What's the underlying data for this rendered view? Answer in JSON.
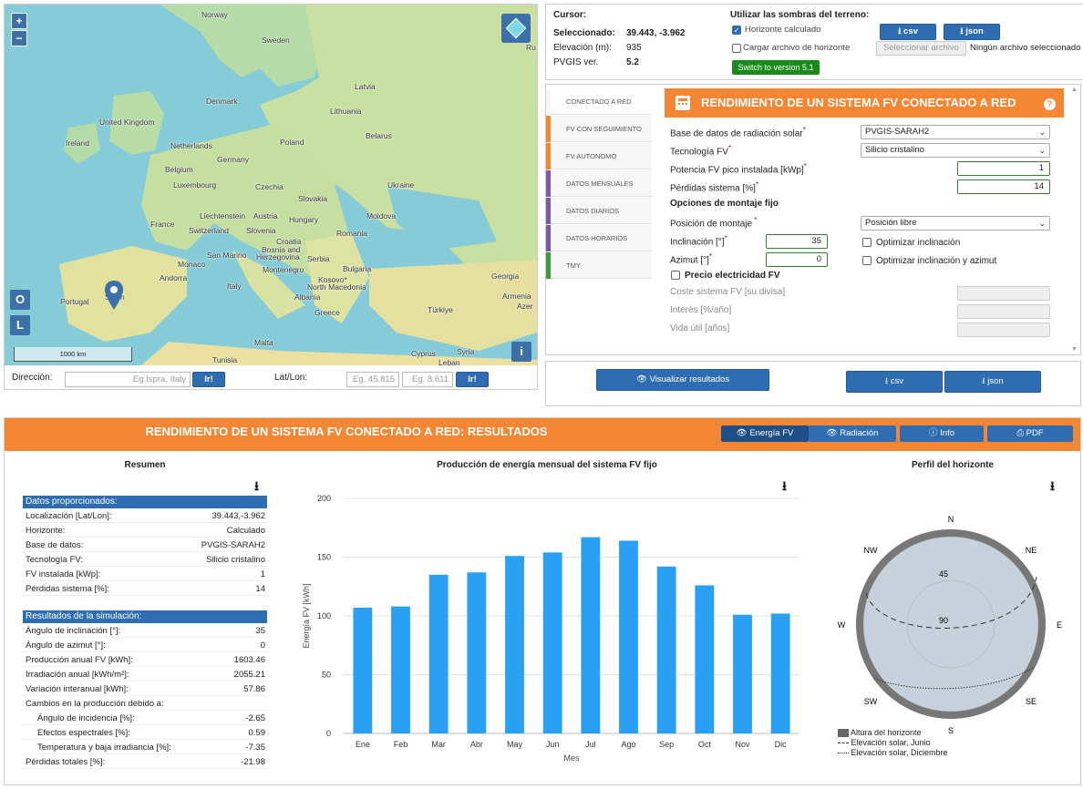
{
  "map": {
    "zoom_in": "+",
    "zoom_out": "−",
    "btn_o": "O",
    "btn_l": "L",
    "btn_i": "i",
    "scale": "1000 km",
    "labels": [
      {
        "t": "Norway",
        "key": "norway"
      },
      {
        "t": "Sweden",
        "key": "sweden"
      },
      {
        "t": "Latvia",
        "key": "latvia"
      },
      {
        "t": "Lithuania",
        "key": "lithuania"
      },
      {
        "t": "Denmark",
        "key": "denmark"
      },
      {
        "t": "United Kingdom",
        "key": "uk"
      },
      {
        "t": "Ireland",
        "key": "ireland"
      },
      {
        "t": "Netherlands",
        "key": "netherlands"
      },
      {
        "t": "Belarus",
        "key": "belarus"
      },
      {
        "t": "Germany",
        "key": "germany"
      },
      {
        "t": "Poland",
        "key": "poland"
      },
      {
        "t": "Belgium",
        "key": "belgium"
      },
      {
        "t": "Luxembourg",
        "key": "luxembourg"
      },
      {
        "t": "Czechia",
        "key": "czechia"
      },
      {
        "t": "Ukraine",
        "key": "ukraine"
      },
      {
        "t": "Slovakia",
        "key": "slovakia"
      },
      {
        "t": "Liechtenstein",
        "key": "liechtenstein"
      },
      {
        "t": "Austria",
        "key": "austria"
      },
      {
        "t": "Hungary",
        "key": "hungary"
      },
      {
        "t": "Moldova",
        "key": "moldova"
      },
      {
        "t": "France",
        "key": "france"
      },
      {
        "t": "Switzerland",
        "key": "switzerland"
      },
      {
        "t": "Slovenia",
        "key": "slovenia"
      },
      {
        "t": "Croatia",
        "key": "croatia"
      },
      {
        "t": "Romania",
        "key": "romania"
      },
      {
        "t": "Bosnia and",
        "key": "bosnia1"
      },
      {
        "t": "Herzegovina",
        "key": "bosnia2"
      },
      {
        "t": "San Marino",
        "key": "sanmarino"
      },
      {
        "t": "Serbia",
        "key": "serbia"
      },
      {
        "t": "Monaco",
        "key": "monaco"
      },
      {
        "t": "Montenegro",
        "key": "montenegro"
      },
      {
        "t": "Bulgaria",
        "key": "bulgaria"
      },
      {
        "t": "Andorra",
        "key": "andorra"
      },
      {
        "t": "Kosovo*",
        "key": "kosovo"
      },
      {
        "t": "Italy",
        "key": "italy"
      },
      {
        "t": "North Macedonia",
        "key": "macedonia"
      },
      {
        "t": "Georgia",
        "key": "georgia"
      },
      {
        "t": "Portugal",
        "key": "portugal"
      },
      {
        "t": "Spain",
        "key": "spain"
      },
      {
        "t": "Albania",
        "key": "albania"
      },
      {
        "t": "Armenia",
        "key": "armenia"
      },
      {
        "t": "Azer",
        "key": "azer"
      },
      {
        "t": "Greece",
        "key": "greece"
      },
      {
        "t": "Türkiye",
        "key": "turkiye"
      },
      {
        "t": "Malta",
        "key": "malta"
      },
      {
        "t": "Cyprus",
        "key": "cyprus"
      },
      {
        "t": "Syria",
        "key": "syria"
      },
      {
        "t": "Leban",
        "key": "leban"
      },
      {
        "t": "Tunisia",
        "key": "tunisia"
      },
      {
        "t": "Ru",
        "key": "ru"
      }
    ]
  },
  "address": {
    "direccion_label": "Dirección:",
    "direccion_placeholder": "Eg.Ispra, Italy",
    "go1": "Ir!",
    "latlon_label": "Lat/Lon:",
    "lat_placeholder": "Eg. 45.815",
    "lon_placeholder": "Eg. 8.611",
    "go2": "Ir!"
  },
  "cursor": {
    "cursor_label": "Cursor:",
    "selected_label": "Seleccionado:",
    "selected_value": "39.443, -3.962",
    "elevation_label": "Elevación (m):",
    "elevation_value": "935",
    "version_label": "PVGIS ver.",
    "version_value": "5.2",
    "shadows_label": "Utilizar las sombras del terreno:",
    "horizon_calc": "Horizonte calculado",
    "horizon_upload": "Cargar archivo de horizonte",
    "csv": "csv",
    "json": "json",
    "select_file": "Seleccionar archivo",
    "no_file": "Ningún archivo seleccionado",
    "switch_version": "Switch to version 5.1"
  },
  "sidetabs": [
    {
      "label": "CONECTADO A RED",
      "color": "#f7f7f7"
    },
    {
      "label": "FV CON SEGUIMIENTO",
      "color": "#f58634"
    },
    {
      "label": "FV AUTONOMO",
      "color": "#f58634"
    },
    {
      "label": "DATOS MENSUALES",
      "color": "#7a5aa8"
    },
    {
      "label": "DATOS DIARIOS",
      "color": "#7a5aa8"
    },
    {
      "label": "DATOS HORARIOS",
      "color": "#7a5aa8"
    },
    {
      "label": "TMY",
      "color": "#3c9b3c"
    }
  ],
  "form": {
    "title": "RENDIMIENTO DE UN SISTEMA FV CONECTADO A RED",
    "help": "?",
    "db_label": "Base de datos de radiación solar",
    "db_value": "PVGIS-SARAH2",
    "tech_label": "Tecnología FV",
    "tech_value": "Silicio cristalino",
    "power_label": "Potencia FV pico instalada [kWp]",
    "power_value": "1",
    "loss_label": "Pérdidas sistema [%]",
    "loss_value": "14",
    "mount_heading": "Opciones de montaje fijo",
    "mount_label": "Posición de montaje",
    "mount_value": "Posición libre",
    "incl_label": "Inclinación [°]",
    "incl_value": "35",
    "incl_opt": "Optimizar inclinación",
    "azim_label": "Azimut [°]",
    "azim_value": "0",
    "azim_opt": "Optimizar inclinación y azimut",
    "price_label": "Precio electricidad FV",
    "cost_label": "Coste sistema FV [su divisa]",
    "interest_label": "Interés [%/año]",
    "life_label": "Vida útil [años]"
  },
  "actions": {
    "visualize": "Visualizar resultados",
    "csv": "csv",
    "json": "json"
  },
  "results": {
    "title": "RENDIMIENTO DE UN SISTEMA FV CONECTADO A RED: RESULTADOS",
    "tabs": [
      "Energía FV",
      "Radiación",
      "Info",
      "PDF"
    ],
    "summary_title": "Resumen",
    "provided_heading": "Datos proporcionados:",
    "provided": [
      {
        "k": "Localización [Lat/Lon]:",
        "v": "39.443,-3.962"
      },
      {
        "k": "Horizonte:",
        "v": "Calculado"
      },
      {
        "k": "Base de datos:",
        "v": "PVGIS-SARAH2"
      },
      {
        "k": "Tecnología FV:",
        "v": "Silicio cristalino"
      },
      {
        "k": "FV instalada [kWp]:",
        "v": "1"
      },
      {
        "k": "Pérdidas sistema [%]:",
        "v": "14"
      }
    ],
    "sim_heading": "Resultados de la simulación:",
    "sim": [
      {
        "k": "Ángulo de inclinación [°]:",
        "v": "35"
      },
      {
        "k": "Ángulo de azimut [°]:",
        "v": "0"
      },
      {
        "k": "Producción anual FV [kWh]:",
        "v": "1603.46"
      },
      {
        "k": "Irradiación anual [kWh/m²]:",
        "v": "2055.21"
      },
      {
        "k": "Variación interanual [kWh]:",
        "v": "57.86"
      },
      {
        "k": "Cambios en la producción debido a:",
        "v": ""
      },
      {
        "k": "Ángulo de incidencia [%]:",
        "v": "-2.65",
        "indent": true
      },
      {
        "k": "Efectos espectrales [%]:",
        "v": "0.59",
        "indent": true
      },
      {
        "k": "Temperatura y baja irradiancia [%]:",
        "v": "-7.35",
        "indent": true
      },
      {
        "k": "Pérdidas totales [%]:",
        "v": "-21.98"
      }
    ],
    "monthly_title": "Producción de energía mensual del sistema FV fijo",
    "horizon_title": "Perfil del horizonte",
    "horizon": {
      "n": "N",
      "ne": "NE",
      "e": "E",
      "se": "SE",
      "s": "S",
      "sw": "SW",
      "w": "W",
      "nw": "NW",
      "r45": "45",
      "r90": "90",
      "legend": [
        "Altura del horizonte",
        "Elevación solar, Junio",
        "Elevación solar, Diciembre"
      ]
    }
  },
  "chart_data": {
    "type": "bar",
    "title": "Producción de energía mensual del sistema FV fijo",
    "xlabel": "Mes",
    "ylabel": "Energía FV [kWh]",
    "ylim": [
      0,
      200
    ],
    "yticks": [
      0,
      50,
      100,
      150,
      200
    ],
    "categories": [
      "Ene",
      "Feb",
      "Mar",
      "Abr",
      "May",
      "Jun",
      "Jul",
      "Ago",
      "Sep",
      "Oct",
      "Nov",
      "Dic"
    ],
    "values": [
      107,
      108,
      135,
      137,
      151,
      154,
      167,
      164,
      142,
      126,
      101,
      102
    ],
    "color": "#2aa0f5",
    "grid": true
  }
}
